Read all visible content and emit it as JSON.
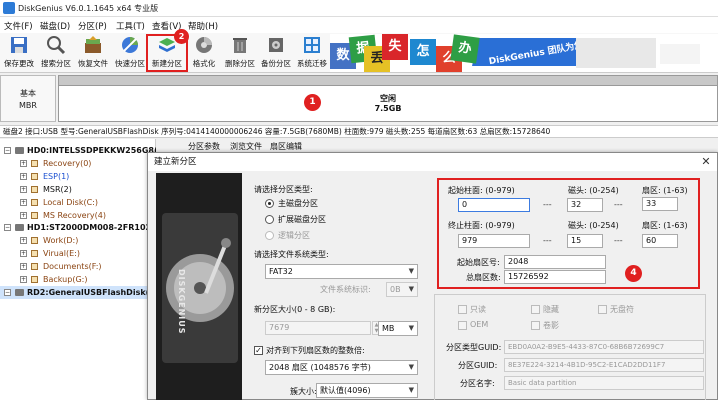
{
  "window": {
    "title": "DiskGenius V6.0.1.1645 x64 专业版"
  },
  "menu": [
    "文件(F)",
    "磁盘(D)",
    "分区(P)",
    "工具(T)",
    "查看(V)",
    "帮助(H)"
  ],
  "toolbar": [
    {
      "label": "保存更改",
      "icon": "save-icon"
    },
    {
      "label": "搜索分区",
      "icon": "search-icon"
    },
    {
      "label": "恢复文件",
      "icon": "recover-icon"
    },
    {
      "label": "快速分区",
      "icon": "quick-partition-icon"
    },
    {
      "label": "新建分区",
      "icon": "new-partition-icon"
    },
    {
      "label": "格式化",
      "icon": "format-icon"
    },
    {
      "label": "删除分区",
      "icon": "delete-icon"
    },
    {
      "label": "备份分区",
      "icon": "backup-icon"
    },
    {
      "label": "系统迁移",
      "icon": "migrate-icon"
    }
  ],
  "banner": {
    "tiles": [
      "数",
      "据",
      "丢",
      "失",
      "怎",
      "么",
      "办"
    ],
    "text": "DiskGenius 团队为您",
    "colors": [
      "#4472c4",
      "#2e9e45",
      "#e5c125",
      "#d9262a",
      "#1e88d0",
      "#e0402c",
      "#2e9e45"
    ]
  },
  "disk_map": {
    "type": "基本",
    "style": "MBR",
    "free_label": "空闲",
    "free_size": "7.5GB"
  },
  "disk_info": "磁盘2 接口:USB 型号:GeneralUSBFlashDisk 序列号:0414140000006246 容量:7.5GB(7680MB) 柱面数:979 磁头数:255 每道扇区数:63 总扇区数:15728640",
  "tree": [
    {
      "label": "HD0:INTELSSDPEKKW256G8(238",
      "level": 0,
      "kind": "disk",
      "color": "#111"
    },
    {
      "label": "Recovery(0)",
      "level": 1,
      "kind": "part",
      "color": "#8b4513"
    },
    {
      "label": "ESP(1)",
      "level": 1,
      "kind": "part",
      "color": "#1a4fd0"
    },
    {
      "label": "MSR(2)",
      "level": 1,
      "kind": "part",
      "color": "#111"
    },
    {
      "label": "Local Disk(C:)",
      "level": 1,
      "kind": "part",
      "color": "#8b4513"
    },
    {
      "label": "MS Recovery(4)",
      "level": 1,
      "kind": "part",
      "color": "#8b4513"
    },
    {
      "label": "HD1:ST2000DM008-2FR102(18",
      "level": 0,
      "kind": "disk",
      "color": "#111"
    },
    {
      "label": "Work(D:)",
      "level": 1,
      "kind": "part",
      "color": "#8b4513"
    },
    {
      "label": "Virual(E:)",
      "level": 1,
      "kind": "part",
      "color": "#8b4513"
    },
    {
      "label": "Documents(F:)",
      "level": 1,
      "kind": "part",
      "color": "#8b4513"
    },
    {
      "label": "Backup(G:)",
      "level": 1,
      "kind": "part",
      "color": "#8b4513"
    },
    {
      "label": "RD2:GeneralUSBFlashDisk(8G",
      "level": 0,
      "kind": "disk",
      "color": "#111"
    }
  ],
  "tabs": [
    "分区参数",
    "浏览文件",
    "扇区编辑"
  ],
  "dialog": {
    "title": "建立新分区",
    "close": "✕",
    "hdd_text": "DISKGENIUS",
    "partition_type_label": "请选择分区类型:",
    "partition_types": [
      {
        "label": "主磁盘分区",
        "selected": true,
        "enabled": true
      },
      {
        "label": "扩展磁盘分区",
        "selected": false,
        "enabled": true
      },
      {
        "label": "逻辑分区",
        "selected": false,
        "enabled": false
      }
    ],
    "fs_label": "请选择文件系统类型:",
    "fs_value": "FAT32",
    "fs_tag_label": "文件系统标识:",
    "fs_tag_value": "0B",
    "size_label": "新分区大小(0 - 8 GB):",
    "size_value": "7679",
    "size_unit": "MB",
    "align_label": "对齐到下列扇区数的整数倍:",
    "align_checked": true,
    "align_value": "2048 扇区 (1048576 字节)",
    "cluster_label": "簇大小:",
    "cluster_value": "默认值(4096)",
    "start_cyl_label": "起始柱面: (0-979)",
    "head_label": "磁头: (0-254)",
    "sector_label": "扇区: (1-63)",
    "start_cyl": "0",
    "start_head": "32",
    "start_sector": "33",
    "end_cyl_label": "终止柱面: (0-979)",
    "end_head_label": "磁头: (0-254)",
    "end_sector_label": "扇区: (1-63)",
    "end_cyl": "979",
    "end_head": "15",
    "end_sector": "60",
    "dash": "---",
    "start_lba_label": "起始扇区号:",
    "start_lba": "2048",
    "total_sectors_label": "总扇区数:",
    "total_sectors": "15726592",
    "checkboxes": [
      {
        "label": "只读",
        "checked": false
      },
      {
        "label": "隐藏",
        "checked": false
      },
      {
        "label": "无盘符",
        "checked": false
      },
      {
        "label": "OEM",
        "checked": false
      },
      {
        "label": "卷影",
        "checked": false
      }
    ],
    "type_guid_label": "分区类型GUID:",
    "type_guid": "EBD0A0A2-B9E5-4433-87C0-68B6B72699C7",
    "part_guid_label": "分区GUID:",
    "part_guid": "8E37E224-3214-4B1D-95C2-E1CAD2DD11F7",
    "part_name_label": "分区名字:",
    "part_name": "Basic data partition"
  },
  "annotations": [
    "1",
    "2",
    "4"
  ]
}
